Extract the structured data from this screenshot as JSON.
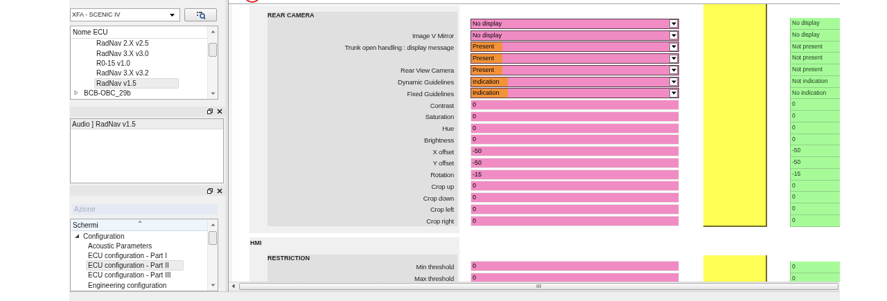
{
  "vehicle_select": {
    "value": "XFA - SCENIC IV"
  },
  "ecu_list": {
    "header": "Nome ECU",
    "items": [
      {
        "label": "RadNav 2.X v2.5",
        "kind": "leaf",
        "selected": false
      },
      {
        "label": "RadNav 3.X v3.0",
        "kind": "leaf",
        "selected": false
      },
      {
        "label": "R0-15 v1.0",
        "kind": "leaf",
        "selected": false
      },
      {
        "label": "RadNav 3.X v3.2",
        "kind": "leaf",
        "selected": false
      },
      {
        "label": "RadNav v1.5",
        "kind": "leaf",
        "selected": true
      },
      {
        "label": "BCB-OBC_29b",
        "kind": "group",
        "expanded": false,
        "selected": false
      }
    ]
  },
  "audio_panel": {
    "items": [
      {
        "label": "Audio ] RadNav v1.5",
        "selected": true
      }
    ]
  },
  "action_field": {
    "placeholder": "Azione"
  },
  "screens_list": {
    "header": "Schermi",
    "items": [
      {
        "label": "Configuration",
        "expanded": true,
        "children": [
          {
            "label": "Acoustic Parameters",
            "selected": false
          },
          {
            "label": "ECU configuration - Part I",
            "selected": false
          },
          {
            "label": "ECU configuration - Part II",
            "selected": true
          },
          {
            "label": "ECU configuration - Part III",
            "selected": false
          },
          {
            "label": "Engineering configuration",
            "selected": false
          }
        ]
      }
    ]
  },
  "rear_camera": {
    "title": "REAR CAMERA",
    "rows": [
      {
        "kind": "dropdown",
        "value": "No display",
        "highlighted": false,
        "reference": "No display"
      },
      {
        "label": "Image V Mirror",
        "kind": "dropdown",
        "value": "No display",
        "highlighted": false,
        "reference": "No display"
      },
      {
        "label": "Trunk open handling : display message",
        "kind": "dropdown",
        "value": "Present",
        "highlighted": true,
        "reference": "Not present"
      },
      {
        "kind": "dropdown",
        "value": "Present",
        "highlighted": true,
        "reference": "Not present"
      },
      {
        "label": "Rear View Camera",
        "kind": "dropdown",
        "value": "Present",
        "highlighted": true,
        "reference": "Not present"
      },
      {
        "label": "Dynamic Guidelines",
        "kind": "dropdown",
        "value": "Indication",
        "highlighted": true,
        "reference": "Not indication"
      },
      {
        "label": "Fixed Guidelines",
        "kind": "dropdown",
        "value": "Indication",
        "highlighted": true,
        "reference": "No indication"
      },
      {
        "label": "Contrast",
        "kind": "text",
        "value": "0",
        "highlighted": false,
        "reference": "0"
      },
      {
        "label": "Saturation",
        "kind": "text",
        "value": "0",
        "highlighted": false,
        "reference": "0"
      },
      {
        "label": "Hue",
        "kind": "text",
        "value": "0",
        "highlighted": false,
        "reference": "0"
      },
      {
        "label": "Brightness",
        "kind": "text",
        "value": "0",
        "highlighted": false,
        "reference": "0"
      },
      {
        "label": "X offset",
        "kind": "text",
        "value": "-50",
        "highlighted": false,
        "reference": "-50"
      },
      {
        "label": "Y offset",
        "kind": "text",
        "value": "-50",
        "highlighted": false,
        "reference": "-50"
      },
      {
        "label": "Rotation",
        "kind": "text",
        "value": "-15",
        "highlighted": false,
        "reference": "-15"
      },
      {
        "label": "Crop up",
        "kind": "text",
        "value": "0",
        "highlighted": false,
        "reference": "0"
      },
      {
        "label": "Crop down",
        "kind": "text",
        "value": "0",
        "highlighted": false,
        "reference": "0"
      },
      {
        "label": "Crop left",
        "kind": "text",
        "value": "0",
        "highlighted": false,
        "reference": "0"
      },
      {
        "label": "Crop right",
        "kind": "text",
        "value": "0",
        "highlighted": false,
        "reference": "0"
      }
    ]
  },
  "hmi": {
    "title": "HMI",
    "subtitle": "RESTRICTION",
    "rows": [
      {
        "label": "Min threshold",
        "kind": "text",
        "value": "0",
        "highlighted": false,
        "reference": "0"
      },
      {
        "label": "Max threshold",
        "kind": "text",
        "value": "0",
        "highlighted": false,
        "reference": "0"
      }
    ]
  }
}
